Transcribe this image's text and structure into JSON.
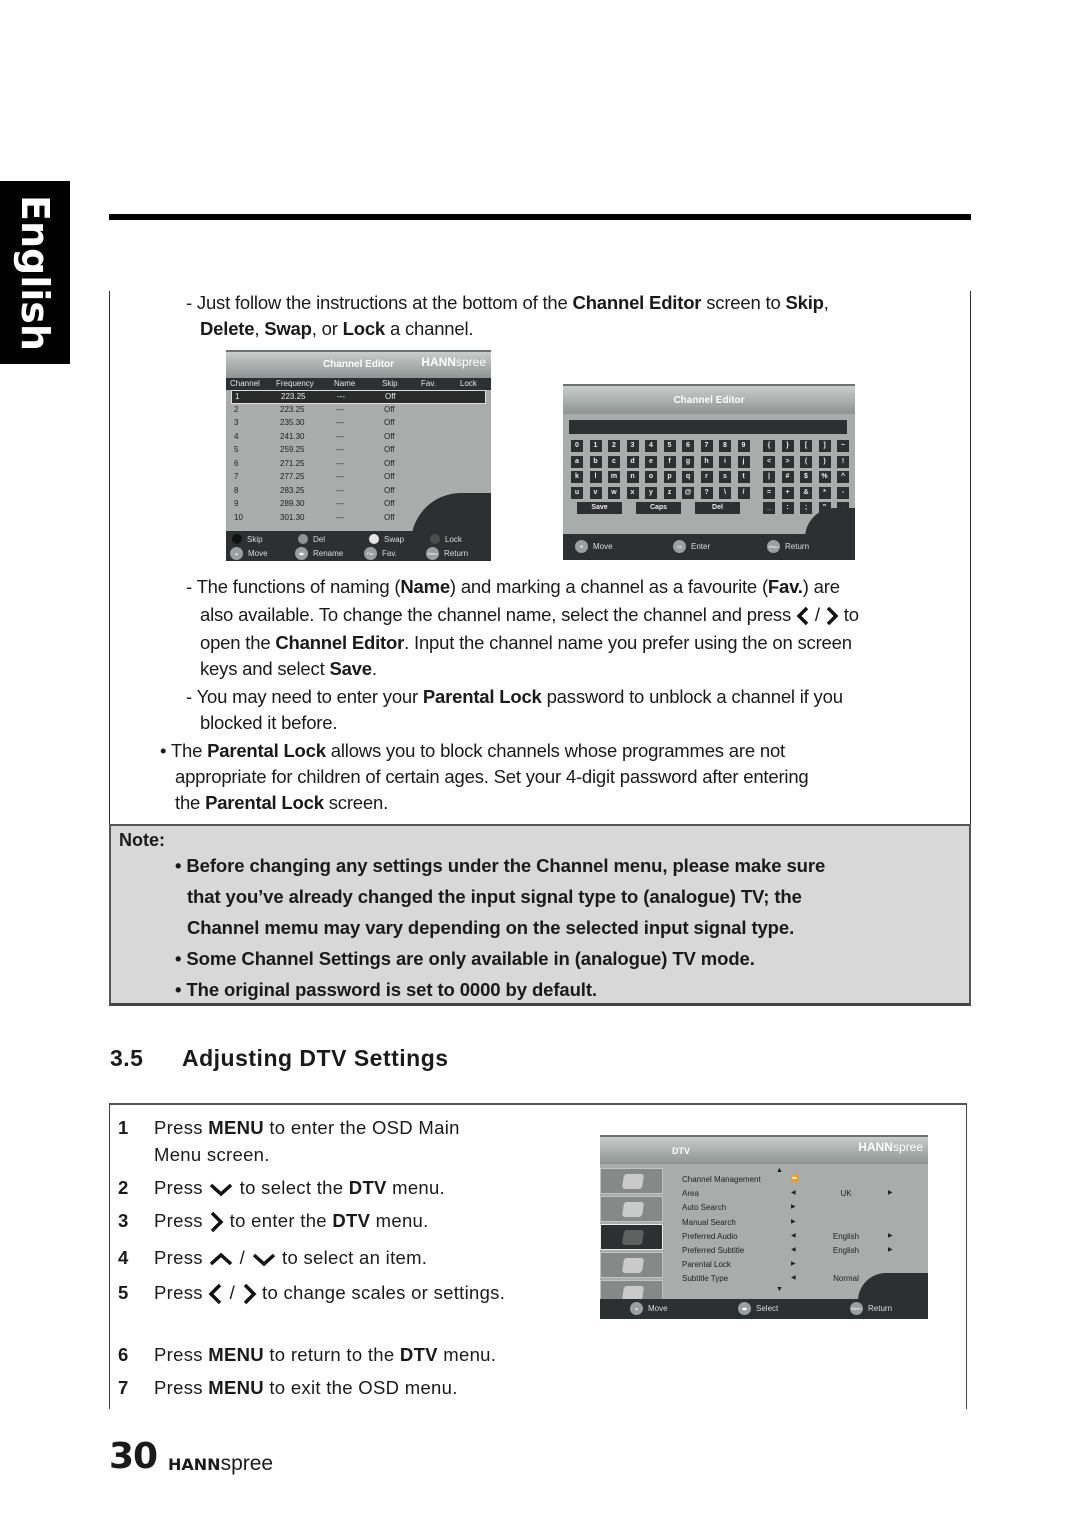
{
  "side_tab": "English",
  "paragraphs": {
    "skip_delete": {
      "p1": "- Just follow the instructions at the bottom of the ",
      "b1": "Channel Editor",
      "p2": " screen to ",
      "b2": "Skip",
      "p3": ",",
      "b3": "Delete",
      "p4": ", ",
      "b4": "Swap",
      "p5": ", or ",
      "b5": "Lock",
      "p6": " a channel."
    },
    "naming": {
      "p1": "- The functions of naming (",
      "b1": "Name",
      "p2": ") and marking a channel as a favourite (",
      "b2": "Fav.",
      "p3": ") are",
      "p4": "also available. To change the channel name, select the channel and press ",
      "p5": " / ",
      "p6": " to",
      "p7": "open the ",
      "b3": "Channel Editor",
      "p8": ". Input the channel name you prefer using the on screen",
      "p9": "keys and select ",
      "b4": "Save",
      "p10": "."
    },
    "unblock": {
      "p1": "- You may need to enter your ",
      "b1": "Parental Lock",
      "p2": " password to unblock a channel if you",
      "p3": "blocked it before."
    },
    "parental": {
      "p1": "• The ",
      "b1": "Parental Lock",
      "p2": " allows you to block channels whose programmes are not",
      "p3": "appropriate for children of certain ages. Set your 4-digit password after entering",
      "p4": "the ",
      "b2": "Parental Lock",
      "p5": " screen."
    }
  },
  "channel_list_osd": {
    "title": "Channel Editor",
    "logo_bold": "HANN",
    "logo_light": "spree",
    "columns": [
      "Channel",
      "Frequency",
      "Name",
      "Skip",
      "Fav.",
      "Lock"
    ],
    "rows": [
      {
        "ch": "1",
        "freq": "223.25",
        "name": "---",
        "skip": "Off"
      },
      {
        "ch": "2",
        "freq": "223.25",
        "name": "---",
        "skip": "Off"
      },
      {
        "ch": "3",
        "freq": "235.30",
        "name": "---",
        "skip": "Off"
      },
      {
        "ch": "4",
        "freq": "241.30",
        "name": "---",
        "skip": "Off"
      },
      {
        "ch": "5",
        "freq": "259.25",
        "name": "---",
        "skip": "Off"
      },
      {
        "ch": "6",
        "freq": "271.25",
        "name": "---",
        "skip": "Off"
      },
      {
        "ch": "7",
        "freq": "277.25",
        "name": "---",
        "skip": "Off"
      },
      {
        "ch": "8",
        "freq": "283.25",
        "name": "---",
        "skip": "Off"
      },
      {
        "ch": "9",
        "freq": "289.30",
        "name": "---",
        "skip": "Off"
      },
      {
        "ch": "10",
        "freq": "301.30",
        "name": "---",
        "skip": "Off"
      }
    ],
    "legend": {
      "skip": "Skip",
      "del": "Del",
      "swap": "Swap",
      "lock": "Lock",
      "move": "Move",
      "rename": "Rename",
      "fav": "Fav.",
      "return": "Return",
      "fav_btn": "Fav.",
      "menu_btn": "Menu"
    },
    "colors": {
      "skip": "#111111",
      "del": "#8f9594",
      "swap": "#e4e6e5",
      "lock": "#4a4f4e"
    }
  },
  "keyboard_osd": {
    "title": "Channel Editor",
    "rows_left": [
      [
        "0",
        "1",
        "2",
        "3",
        "4",
        "5",
        "6",
        "7",
        "8",
        "9"
      ],
      [
        "a",
        "b",
        "c",
        "d",
        "e",
        "f",
        "g",
        "h",
        "i",
        "j"
      ],
      [
        "k",
        "l",
        "m",
        "n",
        "o",
        "p",
        "q",
        "r",
        "s",
        "t"
      ],
      [
        "u",
        "v",
        "w",
        "x",
        "y",
        "z",
        "@",
        "?",
        "\\",
        "/"
      ]
    ],
    "rows_right": [
      [
        "{",
        "}",
        "[",
        "]",
        "~"
      ],
      [
        "<",
        ">",
        "(",
        ")",
        "!"
      ],
      [
        "|",
        "#",
        "$",
        "%",
        "^"
      ],
      [
        "=",
        "+",
        "&",
        "*",
        "-"
      ],
      [
        "_",
        ":",
        ";",
        "\"",
        ","
      ]
    ],
    "buttons": [
      "Save",
      "Caps",
      "Del"
    ],
    "footer": {
      "move": "Move",
      "enter": "Enter",
      "return": "Return",
      "ok_btn": "Ok",
      "menu_btn": "Menu"
    }
  },
  "note": {
    "title": "Note:",
    "items": [
      {
        "l1": "• Before changing any settings under the Channel menu, please make sure",
        "l2": "that you’ve already changed the input signal type to (analogue) TV; the",
        "l3": "Channel memu may vary depending on the selected input signal type."
      },
      {
        "l1": "• Some Channel Settings are only available in (analogue) TV mode."
      },
      {
        "l1": "• The original password is set to 0000 by default."
      }
    ]
  },
  "section": {
    "number": "3.5",
    "title": "Adjusting DTV Settings"
  },
  "steps": [
    {
      "n": "1",
      "a": "Press ",
      "b": "MENU",
      "c": " to enter the OSD Main",
      "d": "Menu screen."
    },
    {
      "n": "2",
      "a": "Press ",
      "c": " to select the ",
      "b": "DTV",
      "d": " menu."
    },
    {
      "n": "3",
      "a": "Press ",
      "c": " to enter the ",
      "b": "DTV",
      "d": " menu."
    },
    {
      "n": "4",
      "a": "Press ",
      "s": " / ",
      "c": " to select an item."
    },
    {
      "n": "5",
      "a": "Press ",
      "s": " / ",
      "c": " to change scales or settings."
    },
    {
      "n": "6",
      "a": "Press ",
      "b": "MENU",
      "c": " to return to the ",
      "b2": "DTV",
      "d": " menu."
    },
    {
      "n": "7",
      "a": "Press ",
      "b": "MENU",
      "c": " to exit the OSD menu."
    }
  ],
  "dtv_osd": {
    "title": "DTV",
    "logo_bold": "HANN",
    "logo_light": "spree",
    "items": [
      {
        "label": "Channel Management",
        "value": ""
      },
      {
        "label": "Area",
        "value": "UK"
      },
      {
        "label": "Auto Search",
        "value": ""
      },
      {
        "label": "Manual Search",
        "value": ""
      },
      {
        "label": "Preferred Audio",
        "value": "English"
      },
      {
        "label": "Preferred Subtitle",
        "value": "English"
      },
      {
        "label": "Parental Lock",
        "value": ""
      },
      {
        "label": "Subtitle Type",
        "value": "Normal"
      }
    ],
    "footer": {
      "move": "Move",
      "select": "Select",
      "return": "Return",
      "menu_btn": "Menu"
    }
  },
  "footer": {
    "page_number": "30",
    "logo_bold": "HANN",
    "logo_light": "spree"
  }
}
